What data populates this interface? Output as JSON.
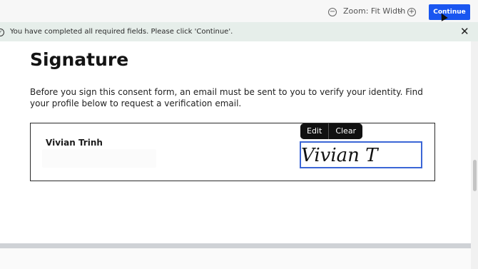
{
  "toolbar": {
    "zoom_label": "Zoom: Fit Width",
    "zoom_out_icon": "minus-circle-icon",
    "zoom_in_icon": "plus-circle-icon",
    "continue_label": "Continue",
    "continue_color": "#1a56f0"
  },
  "notice": {
    "message": "You have completed all required fields. Please click 'Continue'.",
    "icon": "check-circle-icon",
    "close_icon": "close-icon"
  },
  "document": {
    "title": "Signature",
    "intro": "Before you sign this consent form, an email must be sent to you to verify your identity. Find your profile below to request a verification email.",
    "signer_name": "Vivian Trinh",
    "signature_text": "Vivian T",
    "signature_actions": {
      "edit_label": "Edit",
      "clear_label": "Clear"
    },
    "field_highlight_color": "#3b66d6"
  }
}
